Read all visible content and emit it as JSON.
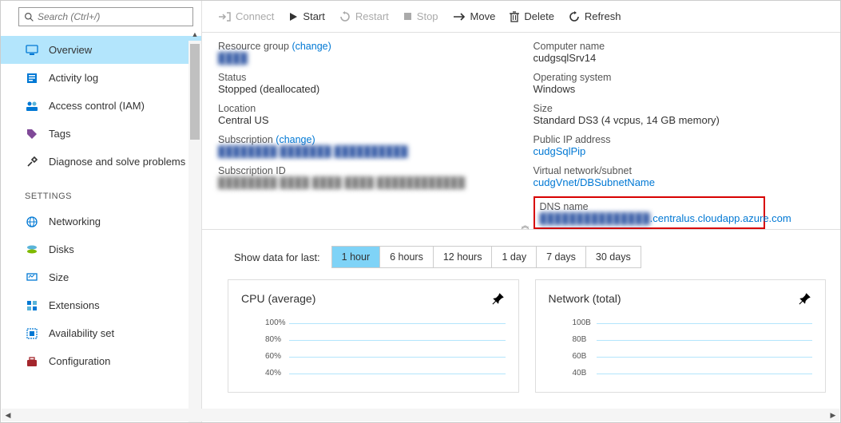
{
  "search": {
    "placeholder": "Search (Ctrl+/)"
  },
  "toolbar": {
    "connect": "Connect",
    "start": "Start",
    "restart": "Restart",
    "stop": "Stop",
    "move": "Move",
    "delete": "Delete",
    "refresh": "Refresh"
  },
  "nav": {
    "overview": "Overview",
    "activity_log": "Activity log",
    "iam": "Access control (IAM)",
    "tags": "Tags",
    "diagnose": "Diagnose and solve problems",
    "settings_header": "SETTINGS",
    "networking": "Networking",
    "disks": "Disks",
    "size": "Size",
    "extensions": "Extensions",
    "availability_set": "Availability set",
    "configuration": "Configuration"
  },
  "change_text": "(change)",
  "left_props": {
    "resource_group_label": "Resource group",
    "resource_group_value": "████",
    "status_label": "Status",
    "status_value": "Stopped (deallocated)",
    "location_label": "Location",
    "location_value": "Central US",
    "subscription_label": "Subscription",
    "subscription_value": "████████ ███████ ██████████",
    "subscription_id_label": "Subscription ID",
    "subscription_id_value": "████████ ████ ████ ████ ████████████"
  },
  "right_props": {
    "computer_name_label": "Computer name",
    "computer_name_value": "cudgsqlSrv14",
    "os_label": "Operating system",
    "os_value": "Windows",
    "size_label": "Size",
    "size_value": "Standard DS3 (4 vcpus, 14 GB memory)",
    "public_ip_label": "Public IP address",
    "public_ip_value": "cudgSqlPip",
    "vnet_label": "Virtual network/subnet",
    "vnet_value": "cudgVnet/DBSubnetName",
    "dns_label": "DNS name",
    "dns_prefix": "███████████████",
    "dns_suffix": ".centralus.cloudapp.azure.com"
  },
  "filter": {
    "label": "Show data for last:",
    "options": [
      "1 hour",
      "6 hours",
      "12 hours",
      "1 day",
      "7 days",
      "30 days"
    ],
    "active_index": 0
  },
  "chart_data": [
    {
      "type": "line",
      "title": "CPU (average)",
      "y_ticks": [
        "100%",
        "80%",
        "60%",
        "40%"
      ]
    },
    {
      "type": "line",
      "title": "Network (total)",
      "y_ticks": [
        "100B",
        "80B",
        "60B",
        "40B"
      ]
    }
  ]
}
